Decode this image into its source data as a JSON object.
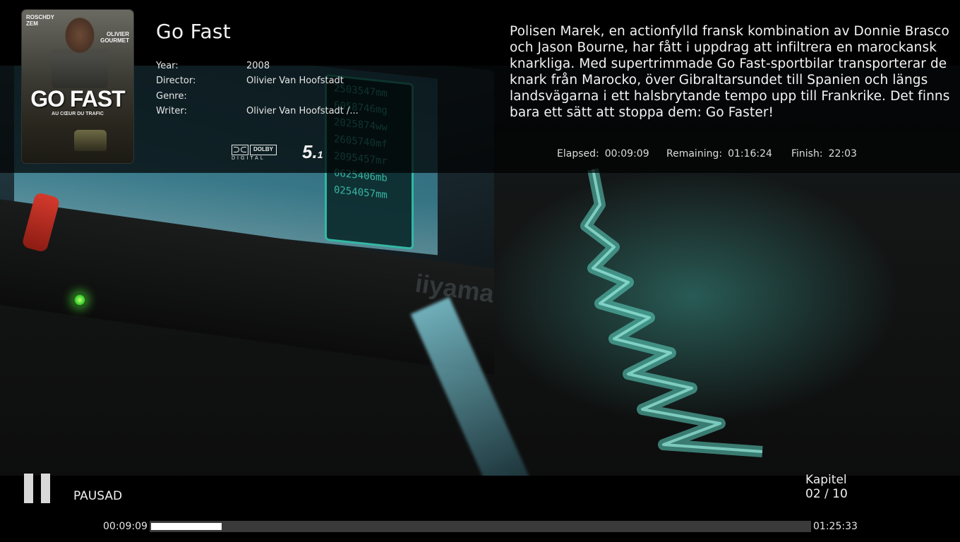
{
  "movie": {
    "title": "Go Fast",
    "poster": {
      "title": "GO FAST",
      "subtitle": "AU CŒUR DU TRAFIC",
      "actor_left": [
        "ROSCHDY",
        "ZEM"
      ],
      "actor_right": [
        "OLIVIER",
        "GOURMET"
      ]
    },
    "meta": {
      "year_label": "Year:",
      "year_value": "2008",
      "director_label": "Director:",
      "director_value": "Olivier Van Hoofstadt",
      "genre_label": "Genre:",
      "genre_value": "",
      "writer_label": "Writer:",
      "writer_value": "Olivier Van Hoofstadt /..."
    },
    "audio": {
      "dolby_word": "DOLBY",
      "dolby_digital": "DIGITAL",
      "channels_main": "5.",
      "channels_sub": "1"
    },
    "plot": "Polisen Marek, en actionfylld fransk kombination av Donnie Brasco och Jason Bourne, har fått i uppdrag att infiltrera en marockansk knarkliga. Med supertrimmade Go Fast-sportbilar transporterar de knark från Marocko, över Gibraltarsundet till Spanien och längs landsvägarna i ett halsbrytande tempo upp till Frankrike. Det finns bara ett sätt att stoppa dem: Go Faster!"
  },
  "timing": {
    "elapsed_label": "Elapsed:",
    "elapsed_value": "00:09:09",
    "remaining_label": "Remaining:",
    "remaining_value": "01:16:24",
    "finish_label": "Finish:",
    "finish_value": "22:03"
  },
  "osd": {
    "state_label": "PAUSAD",
    "state_icon": "pause-icon",
    "chapter_label": "Kapitel",
    "chapter_value": "02 / 10",
    "time_current": "00:09:09",
    "time_total": "01:25:33",
    "progress_fraction": 0.107
  },
  "background": {
    "monitor_brand": "iiyama",
    "panel_readouts": [
      "2503547mm",
      "6058746mg",
      "2025874ww",
      "2605740mf",
      "2095457mr",
      "0625406mb",
      "0254057mm"
    ]
  },
  "colors": {
    "overlay": "#000000",
    "progress_track": "#3a3a3a",
    "progress_fill": "#ffffff",
    "led": "#3dcf2a",
    "accent_teal": "#44e0c4"
  }
}
